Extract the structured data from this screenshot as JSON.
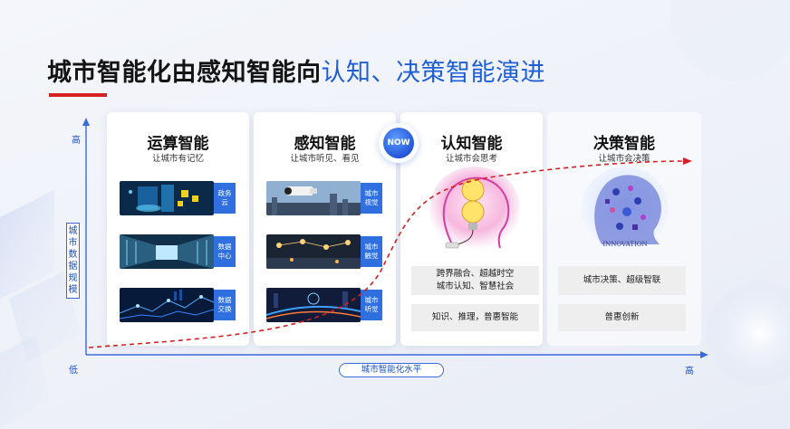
{
  "title": {
    "main": "城市智能化由感知智能向",
    "highlight": "认知、决策智能演进"
  },
  "now_badge": "NOW",
  "axes": {
    "y_high": "高",
    "y_low": "低",
    "x_high": "高",
    "y_label": [
      "城",
      "市",
      "数",
      "据",
      "规",
      "模"
    ],
    "x_label": "城市智能化水平"
  },
  "stages": [
    {
      "title": "运算智能",
      "subtitle": "让城市有记忆",
      "items": [
        {
          "tag": [
            "政务",
            "云"
          ]
        },
        {
          "tag": [
            "数据",
            "中心"
          ]
        },
        {
          "tag": [
            "数据",
            "交换"
          ]
        }
      ]
    },
    {
      "title": "感知智能",
      "subtitle": "让城市听见、看见",
      "items": [
        {
          "tag": [
            "城市",
            "视觉"
          ]
        },
        {
          "tag": [
            "城市",
            "触觉"
          ]
        },
        {
          "tag": [
            "城市",
            "听觉"
          ]
        }
      ]
    },
    {
      "title": "认知智能",
      "subtitle": "让城市会思考",
      "boxes": [
        [
          "跨界融合、超越时空",
          "城市认知、智慧社会"
        ],
        [
          "知识、推理，普惠智能"
        ]
      ]
    },
    {
      "title": "决策智能",
      "subtitle": "让城市会决策",
      "image_caption": "INNOVATION",
      "boxes": [
        [
          "城市决策、超级智联"
        ],
        [
          "普惠创新"
        ]
      ]
    }
  ],
  "colors": {
    "accent_blue": "#1f5fd6",
    "title_bar_red": "#d42020",
    "tag_blue": "#2f6fe0",
    "curve_red": "#d42020"
  }
}
